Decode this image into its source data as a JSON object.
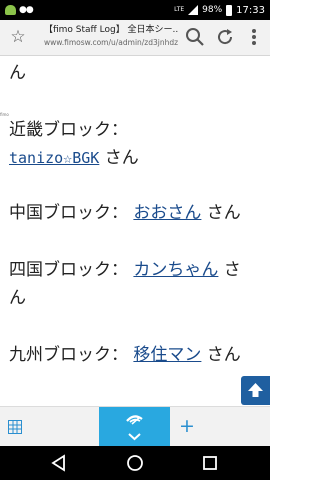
{
  "status_bar": {
    "network": "LTE",
    "battery": "98%",
    "time": "17:33"
  },
  "browser": {
    "tab_title": "【fimo Staff Log】 全日本シー...",
    "url": "www.fimosw.com/u/admin/zd3jnhdz...",
    "favicon_label": "fimo"
  },
  "content": {
    "line_top": "ん",
    "kinki_label": "近畿ブロック：",
    "kinki_user": "tanizo☆BGK",
    "kinki_suffix": " さん",
    "chugoku_label": "中国ブロック：",
    "chugoku_user": "おおさん",
    "chugoku_suffix": " さん",
    "shikoku_label": "四国ブロック：",
    "shikoku_user": "カンちゃん",
    "shikoku_suffix": " さ",
    "shikoku_wrap": "ん",
    "kyushu_label": "九州ブロック：",
    "kyushu_user": "移住マン",
    "kyushu_suffix": " さん"
  },
  "colors": {
    "link": "#1a4b8c",
    "accent": "#29a8e0",
    "scroll_button": "#1f5fa0"
  }
}
